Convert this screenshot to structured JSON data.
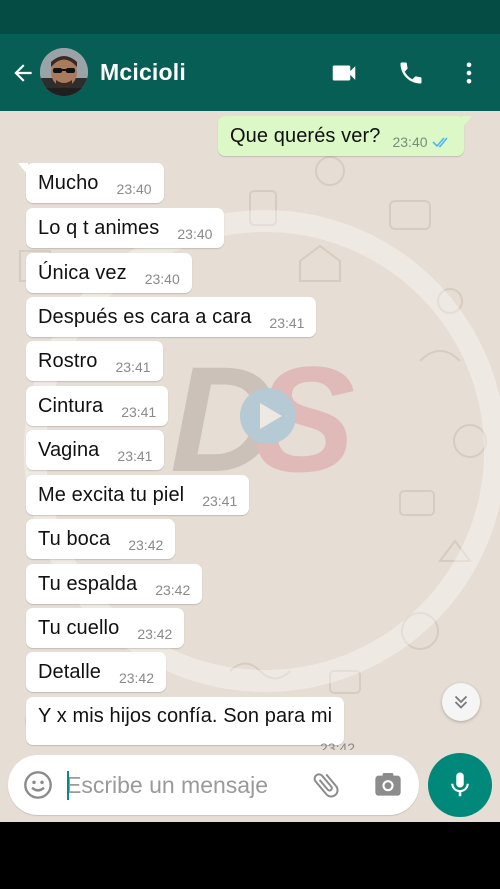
{
  "header": {
    "contact_name": "Mcicioli",
    "icons": {
      "back": "arrow-left-icon",
      "video": "video-call-icon",
      "call": "phone-icon",
      "menu": "more-vert-icon"
    }
  },
  "messages": [
    {
      "direction": "outgoing",
      "text": "Que querés ver?",
      "time": "23:40",
      "status": "read"
    },
    {
      "direction": "incoming",
      "text": "Mucho",
      "time": "23:40"
    },
    {
      "direction": "incoming",
      "text": "Lo q t animes",
      "time": "23:40"
    },
    {
      "direction": "incoming",
      "text": "Única vez",
      "time": "23:40"
    },
    {
      "direction": "incoming",
      "text": "Después es cara a cara",
      "time": "23:41"
    },
    {
      "direction": "incoming",
      "text": "Rostro",
      "time": "23:41"
    },
    {
      "direction": "incoming",
      "text": "Cintura",
      "time": "23:41"
    },
    {
      "direction": "incoming",
      "text": "Vagina",
      "time": "23:41"
    },
    {
      "direction": "incoming",
      "text": "Me excita tu piel",
      "time": "23:41"
    },
    {
      "direction": "incoming",
      "text": "Tu boca",
      "time": "23:42"
    },
    {
      "direction": "incoming",
      "text": "Tu espalda",
      "time": "23:42"
    },
    {
      "direction": "incoming",
      "text": "Tu cuello",
      "time": "23:42"
    },
    {
      "direction": "incoming",
      "text": "Detalle",
      "time": "23:42"
    },
    {
      "direction": "incoming",
      "text": "Y x mis hijos confía. Son para mi",
      "time": "23:42"
    }
  ],
  "composer": {
    "placeholder": "Escribe un mensaje",
    "value": "",
    "icons": {
      "emoji": "emoji-icon",
      "attach": "paperclip-icon",
      "camera": "camera-icon",
      "mic": "microphone-icon",
      "scroll": "chevron-double-down-icon"
    }
  },
  "colors": {
    "header": "#075e54",
    "status_bar": "#054d44",
    "outgoing_bubble": "#dcf8c6",
    "incoming_bubble": "#ffffff",
    "chat_background": "#e6ddd4",
    "accent": "#00897b",
    "read_ticks": "#4fb6ec"
  }
}
